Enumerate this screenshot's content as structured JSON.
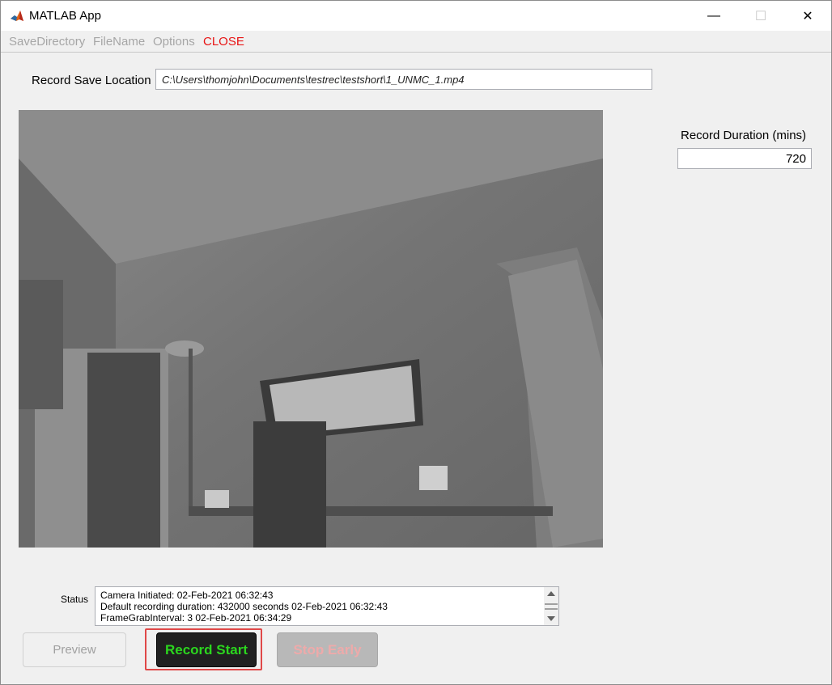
{
  "window": {
    "title": "MATLAB App",
    "minimize_glyph": "—",
    "maximize_glyph": "☐",
    "close_glyph": "✕"
  },
  "menu": {
    "items": [
      "SaveDirectory",
      "FileName",
      "Options",
      "CLOSE"
    ]
  },
  "record_save": {
    "label": "Record Save Location",
    "value": "C:\\Users\\thomjohn\\Documents\\testrec\\testshort\\1_UNMC_1.mp4"
  },
  "duration": {
    "label": "Record Duration (mins)",
    "value": "720"
  },
  "status": {
    "label": "Status",
    "lines": [
      "Camera Initiated: 02-Feb-2021 06:32:43",
      "Default recording duration: 432000 seconds 02-Feb-2021 06:32:43",
      "FrameGrabInterval: 3 02-Feb-2021 06:34:29"
    ]
  },
  "buttons": {
    "preview": "Preview",
    "record_start": "Record Start",
    "stop_early": "Stop Early"
  },
  "colors": {
    "record_text": "#2bd61e",
    "close_menu": "#e81414",
    "highlight": "#e04848"
  },
  "icons": {
    "app": "matlab-logo-icon"
  }
}
